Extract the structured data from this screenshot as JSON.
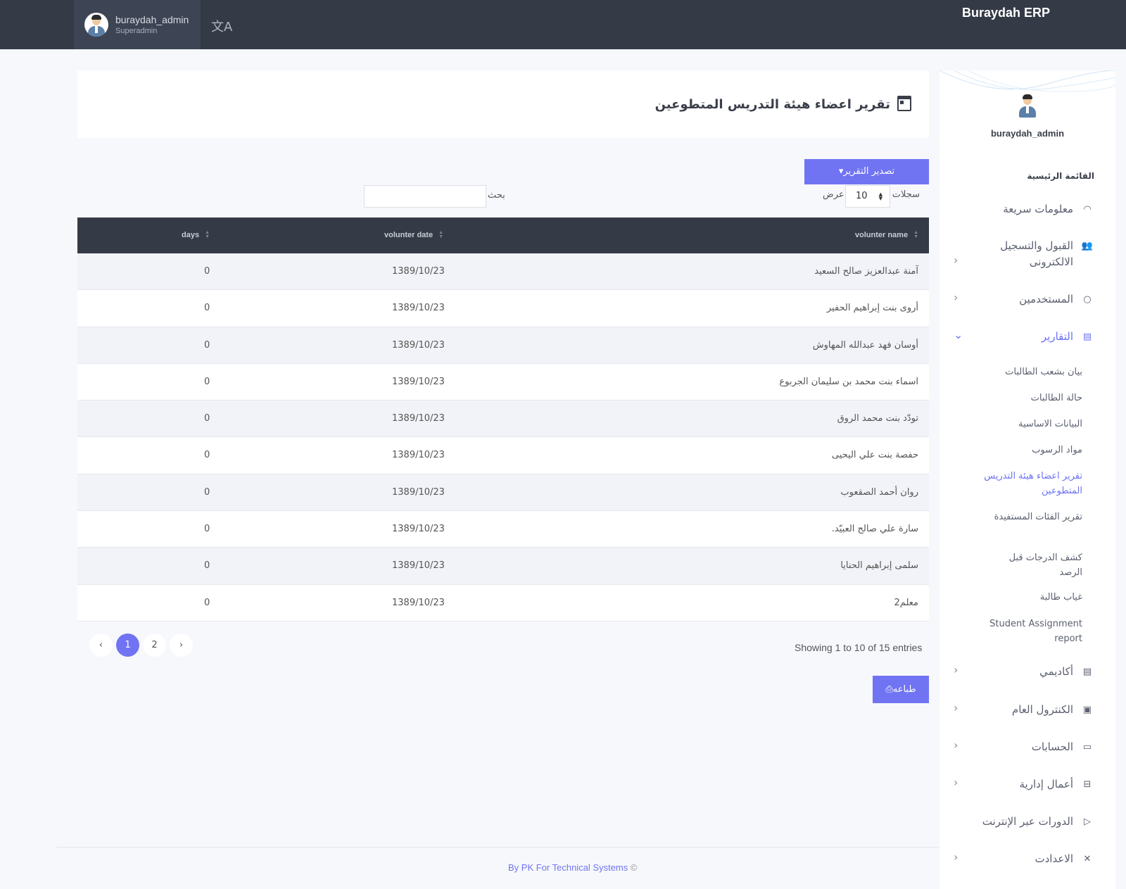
{
  "topbar": {
    "brand": "Buraydah ERP",
    "user_name": "buraydah_admin",
    "user_role": "Superadmin",
    "lang_icon": "translate-icon"
  },
  "sidebar": {
    "user_name": "buraydah_admin",
    "section_title": "القائمة الرئيسية",
    "items": [
      {
        "label": "معلومات سريعة",
        "icon": "speedometer-icon"
      },
      {
        "label": "القبول والتسجيل الالكترونى",
        "icon": "users-icon"
      },
      {
        "label": "المستخدمين",
        "icon": "user-icon"
      },
      {
        "label": "التقارير",
        "icon": "store-icon"
      },
      {
        "label": "أكاديمي",
        "icon": "store-icon"
      },
      {
        "label": "الكنترول العام",
        "icon": "clipboard-icon"
      },
      {
        "label": "الحسابات",
        "icon": "briefcase-icon"
      },
      {
        "label": "أعمال إدارية",
        "icon": "basket-icon"
      },
      {
        "label": "الدورات عبر الإنترنت",
        "icon": "play-icon"
      },
      {
        "label": "الاعدادت",
        "icon": "tools-icon"
      }
    ],
    "report_subitems": [
      "بيان بشعب الطالبات",
      "حالة الطالبات",
      "البيانات الاساسية",
      "مواد الرسوب",
      "تقرير اعضاء هيئة التدريس المتطوعين",
      "تقرير الفئات المستفيدة",
      "كشف الدرجات قبل الرصد",
      "غياب طالبة",
      "Student Assignment report"
    ]
  },
  "page": {
    "title": "تقرير اعضاء هيئة التدريس المتطوعين",
    "export_label": "تصدير التقرير",
    "length_label_right": "سجلات",
    "length_value": "10",
    "length_label_left": "عرض",
    "search_label": "بحث",
    "search_value": "",
    "print_label": "طباعه",
    "info": "Showing 1 to 10 of 15 entries",
    "pages": [
      "1",
      "2"
    ],
    "prev_symbol": "‹",
    "next_symbol": "›"
  },
  "table": {
    "headers": {
      "name": "volunter name",
      "date": "volunter date",
      "days": "days"
    },
    "rows": [
      {
        "name": "آمنة عبدالعزيز صالح السعيد",
        "date": "1389/10/23",
        "days": "0"
      },
      {
        "name": "أروى بنت إبراهيم الحفير",
        "date": "1389/10/23",
        "days": "0"
      },
      {
        "name": "أوسان فهد عبدالله المهاوش",
        "date": "1389/10/23",
        "days": "0"
      },
      {
        "name": "اسماء بنت محمد بن سليمان الجربوع",
        "date": "1389/10/23",
        "days": "0"
      },
      {
        "name": "تودّد بنت محمد الروق",
        "date": "1389/10/23",
        "days": "0"
      },
      {
        "name": "حفصة بنت علي اليحيى",
        "date": "1389/10/23",
        "days": "0"
      },
      {
        "name": "روان أحمد الصقعوب",
        "date": "1389/10/23",
        "days": "0"
      },
      {
        "name": "سارة علي صالح العبيّد.",
        "date": "1389/10/23",
        "days": "0"
      },
      {
        "name": "سلمى إبراهيم الحنايا",
        "date": "1389/10/23",
        "days": "0"
      },
      {
        "name": "معلم2",
        "date": "1389/10/23",
        "days": "0"
      }
    ]
  },
  "footer": {
    "text": "By PK For Technical Systems",
    "copyright": "©"
  },
  "colors": {
    "accent": "#7074f2",
    "topbar": "#343a46",
    "table_header": "#343a46"
  }
}
